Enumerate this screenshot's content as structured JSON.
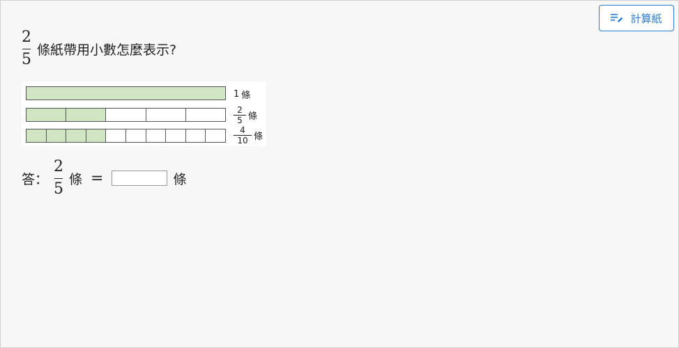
{
  "toolbar": {
    "scratch_label": "計算紙",
    "icon": "edit-notes-icon"
  },
  "question": {
    "numerator": "2",
    "denominator": "5",
    "text": "條紙帶用小數怎麼表示?"
  },
  "figure": {
    "strips": [
      {
        "label_whole": "1",
        "label_unit": "條",
        "cells": 1,
        "filled": 1
      },
      {
        "label_num": "2",
        "label_den": "5",
        "label_unit": "條",
        "cells": 5,
        "filled": 2
      },
      {
        "label_num": "4",
        "label_den": "10",
        "label_unit": "條",
        "cells": 10,
        "filled": 4
      }
    ],
    "fill_color": "#d0e6c3"
  },
  "answer": {
    "prefix": "答：",
    "numerator": "2",
    "denominator": "5",
    "unit": "條",
    "equals": "=",
    "input_value": "",
    "suffix": "條"
  },
  "colors": {
    "accent": "#2a7bd2",
    "background": "#f7f7f7"
  }
}
